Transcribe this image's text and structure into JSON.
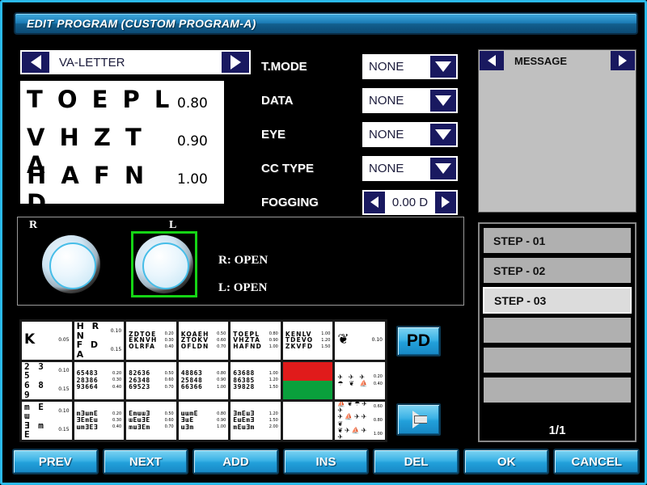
{
  "window": {
    "title": "EDIT PROGRAM (CUSTOM PROGRAM-A)"
  },
  "selector": {
    "value": "VA-LETTER",
    "prev_icon": "triangle-left-icon",
    "next_icon": "triangle-right-icon"
  },
  "chart_preview": {
    "rows": [
      {
        "letters": "T O E P L",
        "va": "0.80"
      },
      {
        "letters": "V H Z T A",
        "va": "0.90"
      },
      {
        "letters": "H A F N D",
        "va": "1.00"
      }
    ]
  },
  "params": [
    {
      "label": "T.MODE",
      "value": "NONE",
      "type": "dropdown"
    },
    {
      "label": "DATA",
      "value": "NONE",
      "type": "dropdown"
    },
    {
      "label": "EYE",
      "value": "NONE",
      "type": "dropdown"
    },
    {
      "label": "CC TYPE",
      "value": "NONE",
      "type": "dropdown"
    },
    {
      "label": "FOGGING",
      "value": "0.00 D",
      "type": "stepper"
    }
  ],
  "message": {
    "title": "MESSAGE",
    "body": ""
  },
  "lens": {
    "right_label": "R",
    "left_label": "L",
    "right_status": "R: OPEN",
    "left_status": "L: OPEN",
    "selected": "L"
  },
  "thumbnails": [
    {
      "kind": "letters",
      "size": "big",
      "lines": [
        {
          "opt": "K",
          "va": "0.05"
        }
      ]
    },
    {
      "kind": "letters",
      "size": "mid",
      "lines": [
        {
          "opt": "H R N",
          "va": "0.10"
        },
        {
          "opt": "F D A",
          "va": "0.15"
        }
      ]
    },
    {
      "kind": "letters",
      "size": "sm",
      "lines": [
        {
          "opt": "ZDTOE",
          "va": "0.20"
        },
        {
          "opt": "EKNVH",
          "va": "0.30"
        },
        {
          "opt": "OLRFA",
          "va": "0.40"
        }
      ]
    },
    {
      "kind": "letters",
      "size": "sm",
      "lines": [
        {
          "opt": "KOAEH",
          "va": "0.50"
        },
        {
          "opt": "ZTOKV",
          "va": "0.60"
        },
        {
          "opt": "OFLDN",
          "va": "0.70"
        }
      ]
    },
    {
      "kind": "letters",
      "size": "sm",
      "lines": [
        {
          "opt": "TOEPL",
          "va": "0.80"
        },
        {
          "opt": "VHZTA",
          "va": "0.90"
        },
        {
          "opt": "HAFND",
          "va": "1.00"
        }
      ]
    },
    {
      "kind": "letters",
      "size": "sm",
      "lines": [
        {
          "opt": "KENLV",
          "va": "1.00"
        },
        {
          "opt": "TDEVO",
          "va": "1.20"
        },
        {
          "opt": "ZKVFD",
          "va": "1.50"
        }
      ]
    },
    {
      "kind": "picture",
      "size": "big",
      "lines": [
        {
          "opt": "❦",
          "va": "0.10"
        }
      ]
    },
    {
      "kind": "numbers",
      "size": "mid",
      "lines": [
        {
          "opt": "2 3 5",
          "va": "0.10"
        },
        {
          "opt": "6 8 9",
          "va": "0.15"
        }
      ]
    },
    {
      "kind": "numbers",
      "size": "sm",
      "lines": [
        {
          "opt": "65483",
          "va": "0.20"
        },
        {
          "opt": "28386",
          "va": "0.30"
        },
        {
          "opt": "93664",
          "va": "0.40"
        }
      ]
    },
    {
      "kind": "numbers",
      "size": "sm",
      "lines": [
        {
          "opt": "82636",
          "va": "0.50"
        },
        {
          "opt": "26348",
          "va": "0.60"
        },
        {
          "opt": "69523",
          "va": "0.70"
        }
      ]
    },
    {
      "kind": "numbers",
      "size": "sm",
      "lines": [
        {
          "opt": "48863",
          "va": "0.80"
        },
        {
          "opt": "25848",
          "va": "0.90"
        },
        {
          "opt": "66366",
          "va": "1.00"
        }
      ]
    },
    {
      "kind": "numbers",
      "size": "sm",
      "lines": [
        {
          "opt": "63688",
          "va": "1.00"
        },
        {
          "opt": "86385",
          "va": "1.20"
        },
        {
          "opt": "39828",
          "va": "1.50"
        }
      ]
    },
    {
      "kind": "duochrome",
      "size": "sm",
      "lines": []
    },
    {
      "kind": "picture",
      "size": "sm",
      "lines": [
        {
          "opt": "✈ ✈ ✈",
          "va": "0.20"
        },
        {
          "opt": "☂ ❦ ⛵",
          "va": "0.40"
        }
      ]
    },
    {
      "kind": "tumbling",
      "size": "mid",
      "lines": [
        {
          "opt": "m E ɯ",
          "va": "0.10"
        },
        {
          "opt": "Ǝ m E",
          "va": "0.15"
        }
      ]
    },
    {
      "kind": "tumbling",
      "size": "sm",
      "lines": [
        {
          "opt": "mƎɯmE",
          "va": "0.20"
        },
        {
          "opt": "ƎEmEɯ",
          "va": "0.30"
        },
        {
          "opt": "ɯmƎEƎ",
          "va": "0.40"
        }
      ]
    },
    {
      "kind": "tumbling",
      "size": "sm",
      "lines": [
        {
          "opt": "EmɯɯƎ",
          "va": "0.50"
        },
        {
          "opt": "ɯEɯƎE",
          "va": "0.60"
        },
        {
          "opt": "mɯƎEm",
          "va": "0.70"
        }
      ]
    },
    {
      "kind": "tumbling",
      "size": "sm",
      "lines": [
        {
          "opt": "ɯɯmE",
          "va": "0.80"
        },
        {
          "opt": "ƎɯE",
          "va": "0.90"
        },
        {
          "opt": "ɯƎm",
          "va": "1.00"
        }
      ]
    },
    {
      "kind": "tumbling",
      "size": "sm",
      "lines": [
        {
          "opt": "ƎmEɯƎ",
          "va": "1.20"
        },
        {
          "opt": "EɯEmƎ",
          "va": "1.50"
        },
        {
          "opt": "mEɯƎm",
          "va": "2.00"
        }
      ]
    },
    {
      "kind": "blank",
      "size": "sm",
      "lines": []
    },
    {
      "kind": "picture",
      "size": "sm",
      "lines": [
        {
          "opt": "⛵❦☂✈✈",
          "va": "0.60"
        },
        {
          "opt": "✈⛵✈✈❦",
          "va": "0.80"
        },
        {
          "opt": "❦✈⛵✈✈",
          "va": "1.00"
        }
      ]
    }
  ],
  "side_buttons": {
    "pd_label": "PD",
    "next_icon": "arrow-right-icon"
  },
  "steps": {
    "items": [
      {
        "label": "STEP - 01",
        "selected": false,
        "empty": false
      },
      {
        "label": "STEP - 02",
        "selected": false,
        "empty": false
      },
      {
        "label": "STEP - 03",
        "selected": true,
        "empty": false
      },
      {
        "label": "",
        "selected": false,
        "empty": true
      },
      {
        "label": "",
        "selected": false,
        "empty": true
      },
      {
        "label": "",
        "selected": false,
        "empty": true
      }
    ],
    "page": "1/1"
  },
  "bottom_buttons": [
    {
      "label": "PREV"
    },
    {
      "label": "NEXT"
    },
    {
      "label": "ADD"
    },
    {
      "label": "INS"
    },
    {
      "label": "DEL"
    },
    {
      "label": "OK"
    },
    {
      "label": "CANCEL"
    }
  ],
  "colors": {
    "frame": "#2bbaea",
    "title_bg": "#1b7bb5",
    "arrow_button": "#191960",
    "selection_green": "#15d415",
    "duochrome_red": "#e01b1b",
    "duochrome_green": "#0aa03c",
    "panel_gray": "#c0c0c0"
  }
}
